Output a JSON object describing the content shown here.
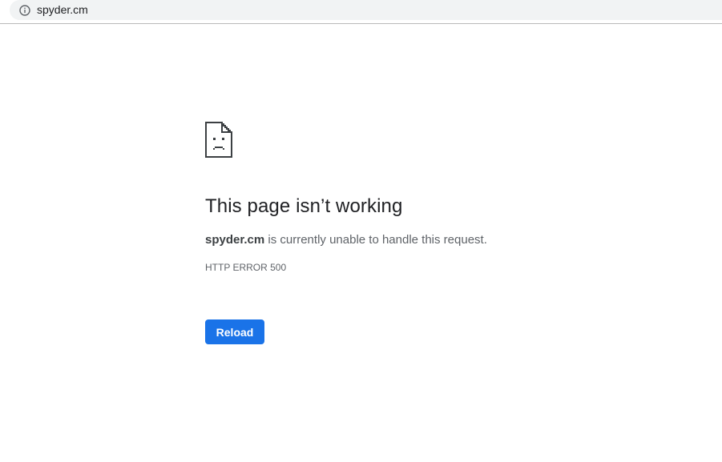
{
  "browser": {
    "url": "spyder.cm",
    "site_info_icon": "info-icon"
  },
  "error_page": {
    "icon": "sad-page-icon",
    "heading": "This page isn’t working",
    "host": "spyder.cm",
    "summary_rest": " is currently unable to handle this request.",
    "error_code": "HTTP ERROR 500",
    "reload_label": "Reload"
  },
  "colors": {
    "accent": "#1a73e8",
    "heading": "#202124",
    "body_text": "#5f6368",
    "omnibox_bg": "#f1f3f4"
  }
}
